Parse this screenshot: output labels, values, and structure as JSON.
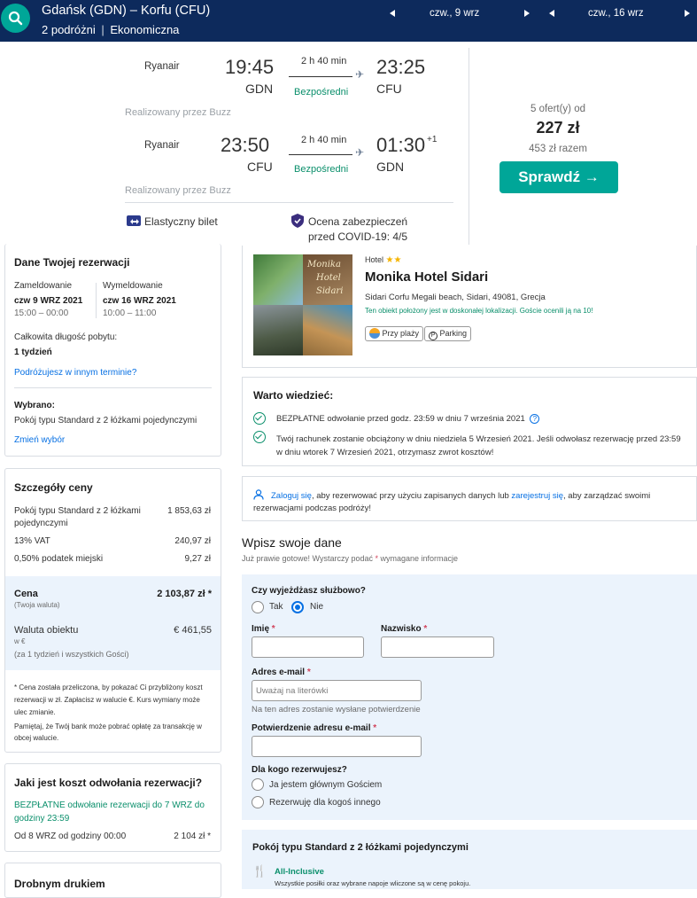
{
  "topbar": {
    "route": "Gdańsk (GDN) – Korfu (CFU)",
    "passengers": "2 podróżni",
    "cabin": "Ekonomiczna",
    "outbound_date": "czw., 9 wrz",
    "return_date": "czw., 16 wrz"
  },
  "flights": [
    {
      "airline": "Ryanair",
      "dep_time": "19:45",
      "dep_code": "GDN",
      "duration": "2 h 40 min",
      "stops": "Bezpośredni",
      "arr_time": "23:25",
      "arr_code": "CFU",
      "day_offset": "",
      "operated_by": "Realizowany przez Buzz"
    },
    {
      "airline": "Ryanair",
      "dep_time": "23:50",
      "dep_code": "CFU",
      "duration": "2 h 40 min",
      "stops": "Bezpośredni",
      "arr_time": "01:30",
      "arr_code": "GDN",
      "day_offset": "+1",
      "operated_by": "Realizowany przez Buzz"
    }
  ],
  "features": {
    "flexible": "Elastyczny bilet",
    "covid_line1": "Ocena zabezpieczeń",
    "covid_line2": "przed COVID-19: 4/5"
  },
  "offer": {
    "count": "5 ofert(y) od",
    "price": "227 zł",
    "total": "453 zł razem",
    "button": "Sprawdź →"
  },
  "booking": {
    "title": "Dane Twojej rezerwacji",
    "checkin_label": "Zameldowanie",
    "checkin_date": "czw 9 WRZ 2021",
    "checkin_time": "15:00 – 00:00",
    "checkout_label": "Wymeldowanie",
    "checkout_date": "czw 16 WRZ 2021",
    "checkout_time": "10:00 – 11:00",
    "length_label": "Całkowita długość pobytu:",
    "length_value": "1 tydzień",
    "other_dates_link": "Podróżujesz w innym terminie?",
    "selected_label": "Wybrano:",
    "selected_value": "Pokój typu Standard z 2 łóżkami pojedynczymi",
    "change_link": "Zmień wybór"
  },
  "price_details": {
    "title": "Szczegóły ceny",
    "rows": [
      {
        "label1": "Pokój typu Standard z 2 łóżkami",
        "label2": "pojedynczymi",
        "value": "1 853,63 zł"
      },
      {
        "label1": "13% VAT",
        "label2": "",
        "value": "240,97 zł"
      },
      {
        "label1": "0,50% podatek miejski",
        "label2": "",
        "value": "9,27 zł"
      }
    ],
    "price_label": "Cena",
    "price_sub": "(Twoja waluta)",
    "price_value": "2 103,87 zł *",
    "prop_currency_label": "Waluta obiektu",
    "prop_currency_sub1": "w €",
    "prop_currency_sub2": "(za 1 tydzień i wszystkich Gości)",
    "prop_currency_value": "€ 461,55",
    "note1_l1": "* Cena została przeliczona, by pokazać Ci przybliżony koszt",
    "note1_l2": "rezerwacji w zł. Zapłacisz w walucie €. Kurs wymiany może",
    "note1_l3": "ulec zmianie.",
    "note2_l1": "Pamiętaj, że Twój bank może pobrać opłatę za transakcję w",
    "note2_l2": "obcej walucie."
  },
  "cancellation": {
    "title": "Jaki jest koszt odwołania rezerwacji?",
    "free_l1": "BEZPŁATNE odwołanie rezerwacji do 7 WRZ do",
    "free_l2": "godziny 23:59",
    "from_label": "Od 8 WRZ od godziny 00:00",
    "from_value": "2 104 zł *"
  },
  "fine_print": {
    "title": "Drobnym drukiem"
  },
  "hotel": {
    "type": "Hotel",
    "stars": "★★",
    "name": "Monika Hotel Sidari",
    "address": "Sidari Corfu Megali beach, Sidari, 49081, Grecja",
    "location_note": "Ten obiekt położony jest w doskonałej lokalizacji. Goście ocenili ją na 10!",
    "badge_beach": "Przy plaży",
    "badge_parking": "Parking",
    "img_text1": "Monika",
    "img_text2": "Hotel",
    "img_text3": "Sidari"
  },
  "good_to_know": {
    "title": "Warto wiedzieć:",
    "item1": "BEZPŁATNE odwołanie przed godz. 23:59 w dniu 7 września 2021",
    "item2_l1": "Twój rachunek zostanie obciążony w dniu niedziela 5 Wrzesień 2021. Jeśli odwołasz rezerwację przed 23:59",
    "item2_l2": "w dniu wtorek 7 Wrzesień 2021, otrzymasz zwrot kosztów!"
  },
  "login": {
    "link_login": "Zaloguj się",
    "text_mid": ", aby rezerwować przy użyciu zapisanych danych lub ",
    "link_register": "zarejestruj się",
    "text_end": ", aby zarządzać swoimi",
    "line2": "rezerwacjami podczas podróży!"
  },
  "form": {
    "title": "Wpisz swoje dane",
    "subtitle_a": "Już prawie gotowe! Wystarczy podać ",
    "subtitle_star": "*",
    "subtitle_b": " wymagane informacje",
    "business_q": "Czy wyjeżdżasz służbowo?",
    "yes": "Tak",
    "no": "Nie",
    "first_name": "Imię",
    "last_name": "Nazwisko",
    "star": "*",
    "email": "Adres e-mail",
    "email_placeholder": "Uważaj na literówki",
    "email_note": "Na ten adres zostanie wysłane potwierdzenie",
    "email_confirm": "Potwierdzenie adresu e-mail",
    "for_whom": "Dla kogo rezerwujesz?",
    "opt_main": "Ja jestem głównym Gościem",
    "opt_other": "Rezerwuję dla kogoś innego"
  },
  "room": {
    "title": "Pokój typu Standard z 2 łóżkami pojedynczymi",
    "meal": "All-Inclusive",
    "meal_desc": "Wszystkie posiłki oraz wybrane napoje wliczone są w cenę pokoju."
  }
}
